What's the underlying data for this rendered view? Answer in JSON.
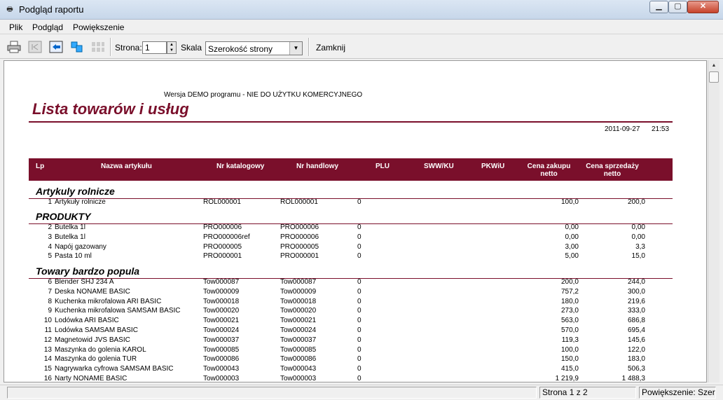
{
  "window": {
    "title": "Podgląd raportu"
  },
  "menu": [
    "Plik",
    "Podgląd",
    "Powiększenie"
  ],
  "toolbar": {
    "page_label": "Strona:",
    "page_value": "1",
    "scale_label": "Skala",
    "scale_value": "Szerokość strony",
    "close_label": "Zamknij"
  },
  "report": {
    "demo_notice": "Wersja DEMO programu - NIE DO UŻYTKU KOMERCYJNEGO",
    "title": "Lista towarów i usług",
    "date": "2011-09-27",
    "time": "21:53",
    "columns": {
      "lp": "Lp",
      "name": "Nazwa artykułu",
      "catalog": "Nr katalogowy",
      "trade": "Nr handlowy",
      "plu": "PLU",
      "sww": "SWW/KU",
      "pkwiu": "PKWiU",
      "buy_line1": "Cena zakupu",
      "buy_line2": "netto",
      "sell_line1": "Cena sprzedaży",
      "sell_line2": "netto"
    },
    "groups": [
      {
        "title": "Artykuly rolnicze",
        "rows": [
          {
            "lp": "1",
            "name": "Artykuły rolnicze",
            "catalog": "ROL000001",
            "trade": "ROL000001",
            "plu": "0",
            "buy": "100,0",
            "sell": "200,0"
          }
        ]
      },
      {
        "title": "PRODUKTY",
        "rows": [
          {
            "lp": "2",
            "name": "Butelka 1l",
            "catalog": "PRO000006",
            "trade": "PRO000006",
            "plu": "0",
            "buy": "0,00",
            "sell": "0,00"
          },
          {
            "lp": "3",
            "name": "Butelka 1l",
            "catalog": "PRO000006ref",
            "trade": "PRO000006",
            "plu": "0",
            "buy": "0,00",
            "sell": "0,00"
          },
          {
            "lp": "4",
            "name": "Napój gazowany",
            "catalog": "PRO000005",
            "trade": "PRO000005",
            "plu": "0",
            "buy": "3,00",
            "sell": "3,3"
          },
          {
            "lp": "5",
            "name": "Pasta 10 ml",
            "catalog": "PRO000001",
            "trade": "PRO000001",
            "plu": "0",
            "buy": "5,00",
            "sell": "15,0"
          }
        ]
      },
      {
        "title": "Towary bardzo popula",
        "rows": [
          {
            "lp": "6",
            "name": "Blender SHJ 234 A",
            "catalog": "Tow000087",
            "trade": "Tow000087",
            "plu": "0",
            "buy": "200,0",
            "sell": "244,0"
          },
          {
            "lp": "7",
            "name": "Deska NONAME BASIC",
            "catalog": "Tow000009",
            "trade": "Tow000009",
            "plu": "0",
            "buy": "757,2",
            "sell": "300,0"
          },
          {
            "lp": "8",
            "name": "Kuchenka mikrofalowa ARI BASIC",
            "catalog": "Tow000018",
            "trade": "Tow000018",
            "plu": "0",
            "buy": "180,0",
            "sell": "219,6"
          },
          {
            "lp": "9",
            "name": "Kuchenka mikrofalowa SAMSAM BASIC",
            "catalog": "Tow000020",
            "trade": "Tow000020",
            "plu": "0",
            "buy": "273,0",
            "sell": "333,0"
          },
          {
            "lp": "10",
            "name": "Lodówka ARI BASIC",
            "catalog": "Tow000021",
            "trade": "Tow000021",
            "plu": "0",
            "buy": "563,0",
            "sell": "686,8"
          },
          {
            "lp": "11",
            "name": "Lodówka SAMSAM BASIC",
            "catalog": "Tow000024",
            "trade": "Tow000024",
            "plu": "0",
            "buy": "570,0",
            "sell": "695,4"
          },
          {
            "lp": "12",
            "name": "Magnetowid JVS BASIC",
            "catalog": "Tow000037",
            "trade": "Tow000037",
            "plu": "0",
            "buy": "119,3",
            "sell": "145,6"
          },
          {
            "lp": "13",
            "name": "Maszynka do golenia KAROL",
            "catalog": "Tow000085",
            "trade": "Tow000085",
            "plu": "0",
            "buy": "100,0",
            "sell": "122,0"
          },
          {
            "lp": "14",
            "name": "Maszynka do golenia TUR",
            "catalog": "Tow000086",
            "trade": "Tow000086",
            "plu": "0",
            "buy": "150,0",
            "sell": "183,0"
          },
          {
            "lp": "15",
            "name": "Nagrywarka cyfrowa SAMSAM BASIC",
            "catalog": "Tow000043",
            "trade": "Tow000043",
            "plu": "0",
            "buy": "415,0",
            "sell": "506,3"
          },
          {
            "lp": "16",
            "name": "Narty NONAME BASIC",
            "catalog": "Tow000003",
            "trade": "Tow000003",
            "plu": "0",
            "buy": "1 219,9",
            "sell": "1 488,3"
          }
        ]
      }
    ]
  },
  "status": {
    "page_info": "Strona 1  z 2",
    "zoom_info": "Powiększenie: Szerol"
  },
  "colors": {
    "accent": "#7a0f2b"
  }
}
